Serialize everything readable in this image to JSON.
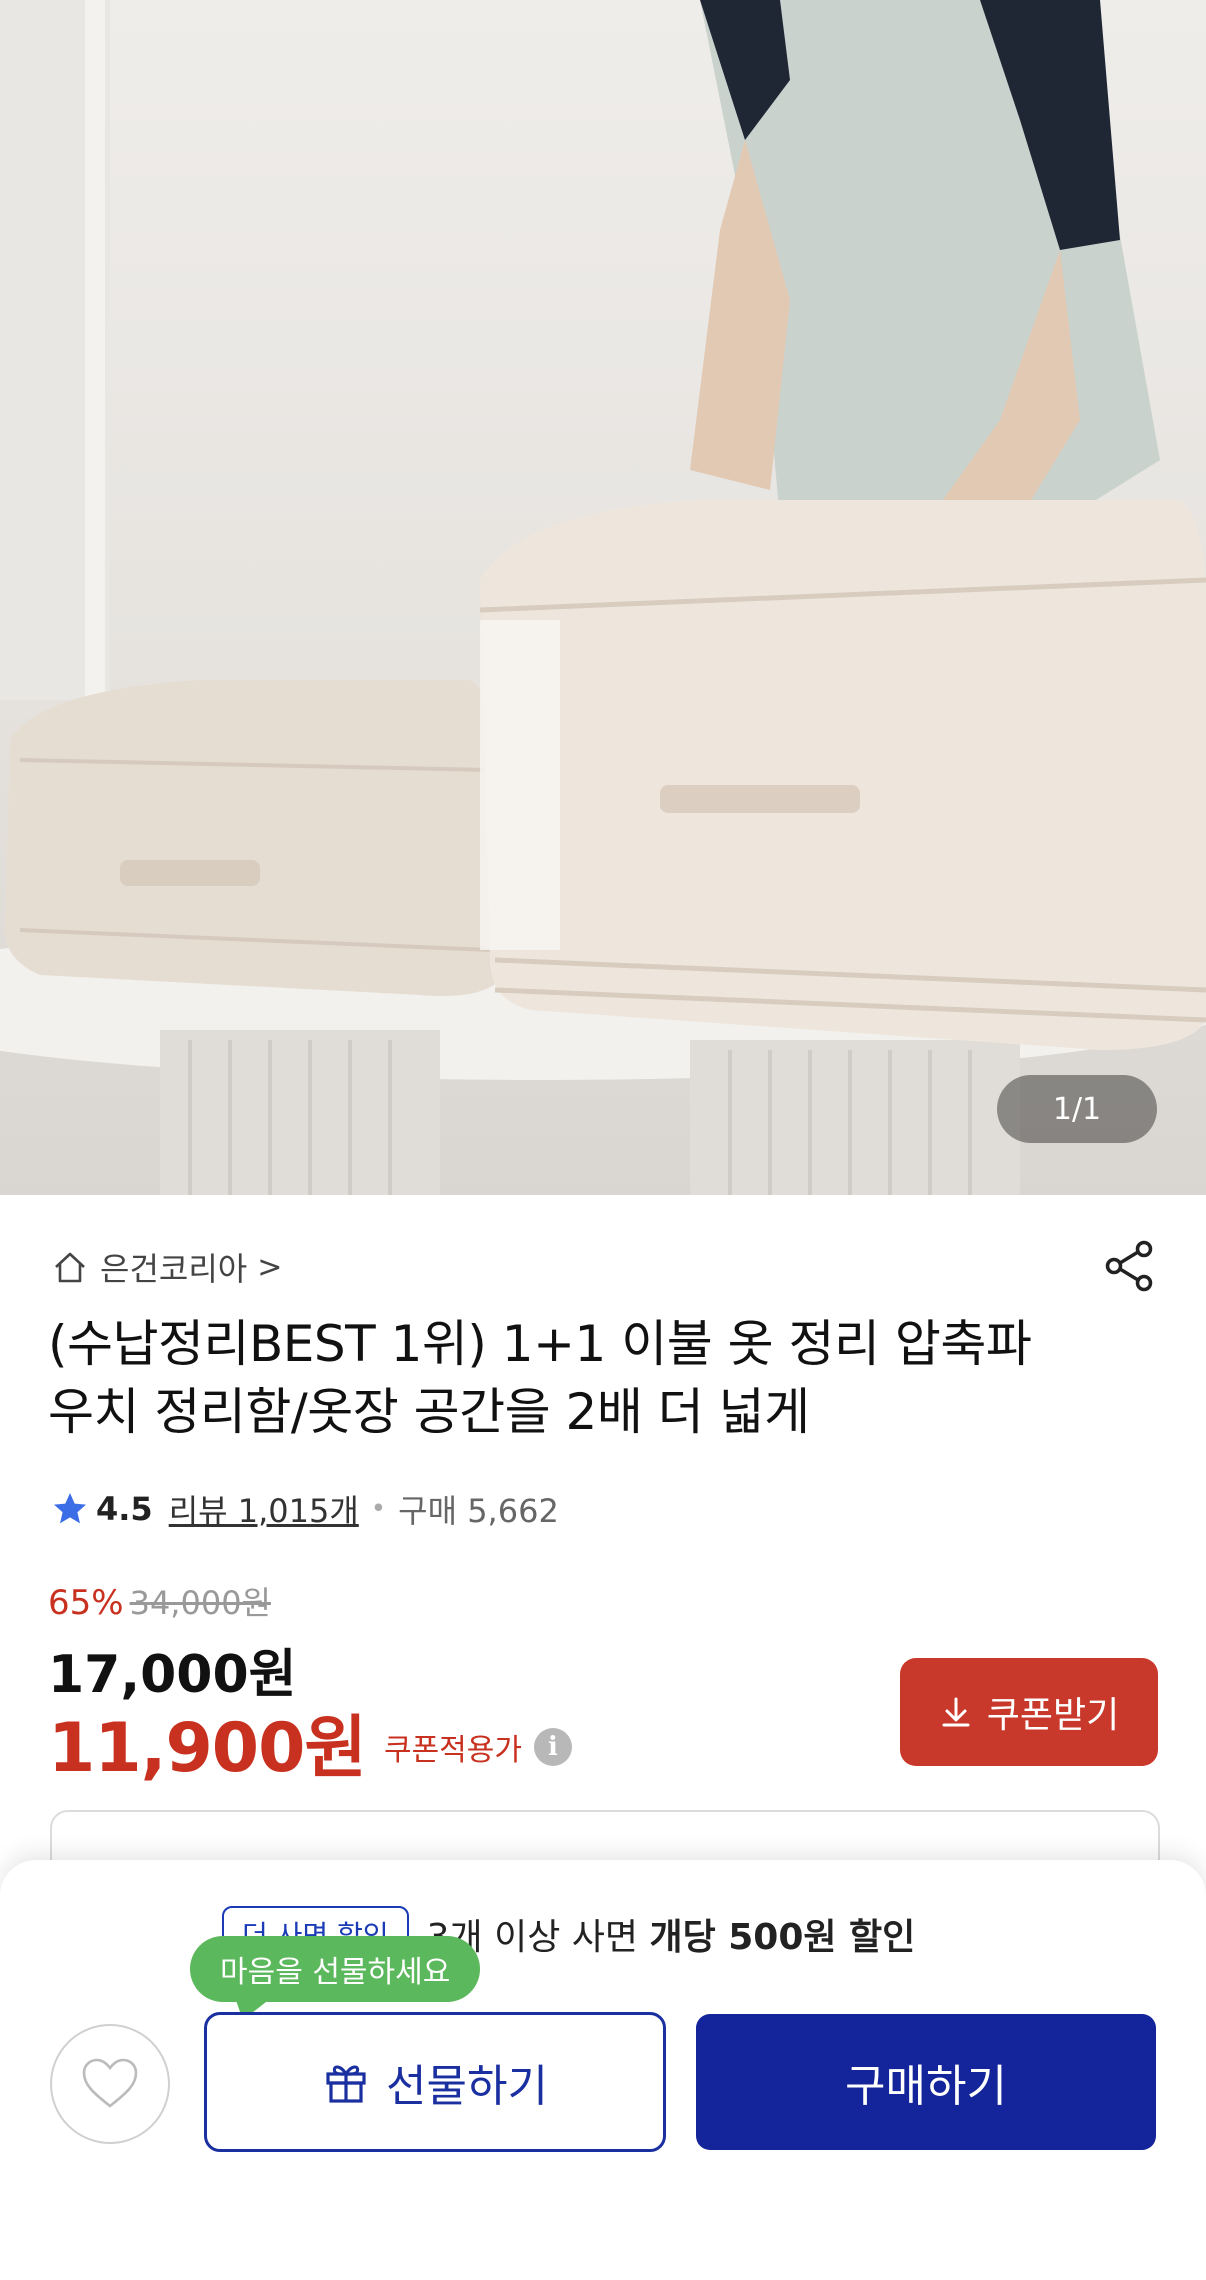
{
  "hero": {
    "page_indicator": "1/1"
  },
  "seller": {
    "name": "은건코리아",
    "chevron": ">"
  },
  "product": {
    "title": "(수납정리BEST 1위) 1+1 이불 옷 정리 압축파우치 정리함/옷장 공간을 2배 더 넓게",
    "rating": "4.5",
    "review_label": "리뷰 1,015개",
    "dot": "•",
    "purchase_label": "구매 5,662"
  },
  "price": {
    "discount_rate": "65%",
    "original_price": "34,000원",
    "sale_price": "17,000원",
    "coupon_price": "11,900원",
    "coupon_note": "쿠폰적용가",
    "info_glyph": "i"
  },
  "coupon_button": {
    "label": "쿠폰받기"
  },
  "bulk_discount": {
    "badge": "더 사면 할인",
    "text_prefix": "3개 이상 사면 ",
    "text_bold": "개당 500원 할인"
  },
  "bottom_bar": {
    "tooltip": "마음을 선물하세요",
    "gift_label": "선물하기",
    "buy_label": "구매하기"
  },
  "colors": {
    "accent_red": "#c8311f",
    "primary_blue": "#14249a",
    "tooltip_green": "#5cb85c",
    "star_blue": "#3b6ee6"
  },
  "icons": [
    "home-icon",
    "share-icon",
    "star-icon",
    "info-icon",
    "download-icon",
    "heart-icon",
    "gift-icon"
  ]
}
